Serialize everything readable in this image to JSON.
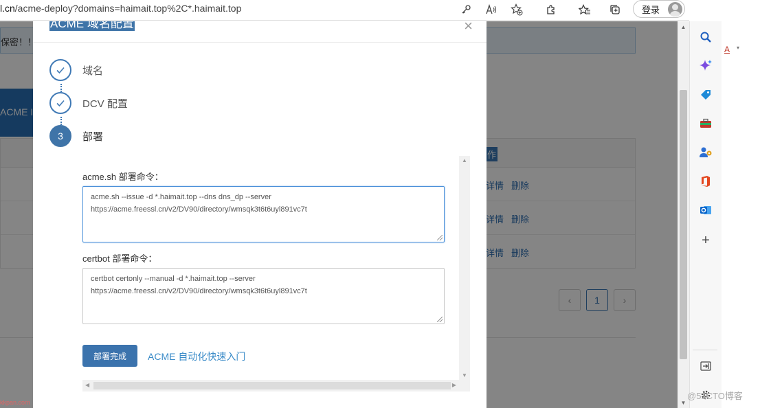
{
  "browser": {
    "url_host": "l.cn",
    "url_path": "/acme-deploy?domains=haimait.top%2C*.haimait.top",
    "login_label": "登录",
    "more_label": "···"
  },
  "page_bg": {
    "warning_text": "保密！！",
    "tab_label": "ACME I",
    "table_header_ops": "作",
    "row_links": [
      {
        "detail": "详情",
        "delete": "删除"
      },
      {
        "detail": "详情",
        "delete": "删除"
      },
      {
        "detail": "详情",
        "delete": "删除"
      }
    ],
    "pager": {
      "prev": "‹",
      "current": "1",
      "next": "›"
    }
  },
  "modal": {
    "title": "ACME 域名配置",
    "close_label": "×",
    "steps": [
      {
        "label": "域名",
        "state": "done"
      },
      {
        "label": "DCV 配置",
        "state": "done"
      },
      {
        "label": "部署",
        "number": "3",
        "state": "active"
      }
    ],
    "acme_sh": {
      "label": "acme.sh 部署命令：",
      "line1": "acme.sh --issue -d *.haimait.top  --dns dns_dp --server",
      "line2": "https://acme.freessl.cn/v2/DV90/directory/wmsqk3t6t6uyl891vc7t"
    },
    "certbot": {
      "label": "certbot 部署命令：",
      "line1": "certbot certonly --manual -d *.haimait.top  --server",
      "line2": "https://acme.freessl.cn/v2/DV90/directory/wmsqk3t6t6uyl891vc7t"
    },
    "done_button": "部署完成",
    "quick_link": "ACME 自动化快速入门"
  },
  "edge_sidebar": {
    "strip_text": "A",
    "icons": [
      "search-icon",
      "copilot-icon",
      "shopping-tag-icon",
      "toolbox-icon",
      "people-icon",
      "office-icon",
      "outlook-icon",
      "add-icon"
    ]
  },
  "watermarks": {
    "left": "kkpan.com",
    "right": "@51CTO博客"
  },
  "colors": {
    "primary": "#3b73ad",
    "link": "#3a8bc8",
    "overlay": "rgba(0,0,0,0.48)"
  }
}
